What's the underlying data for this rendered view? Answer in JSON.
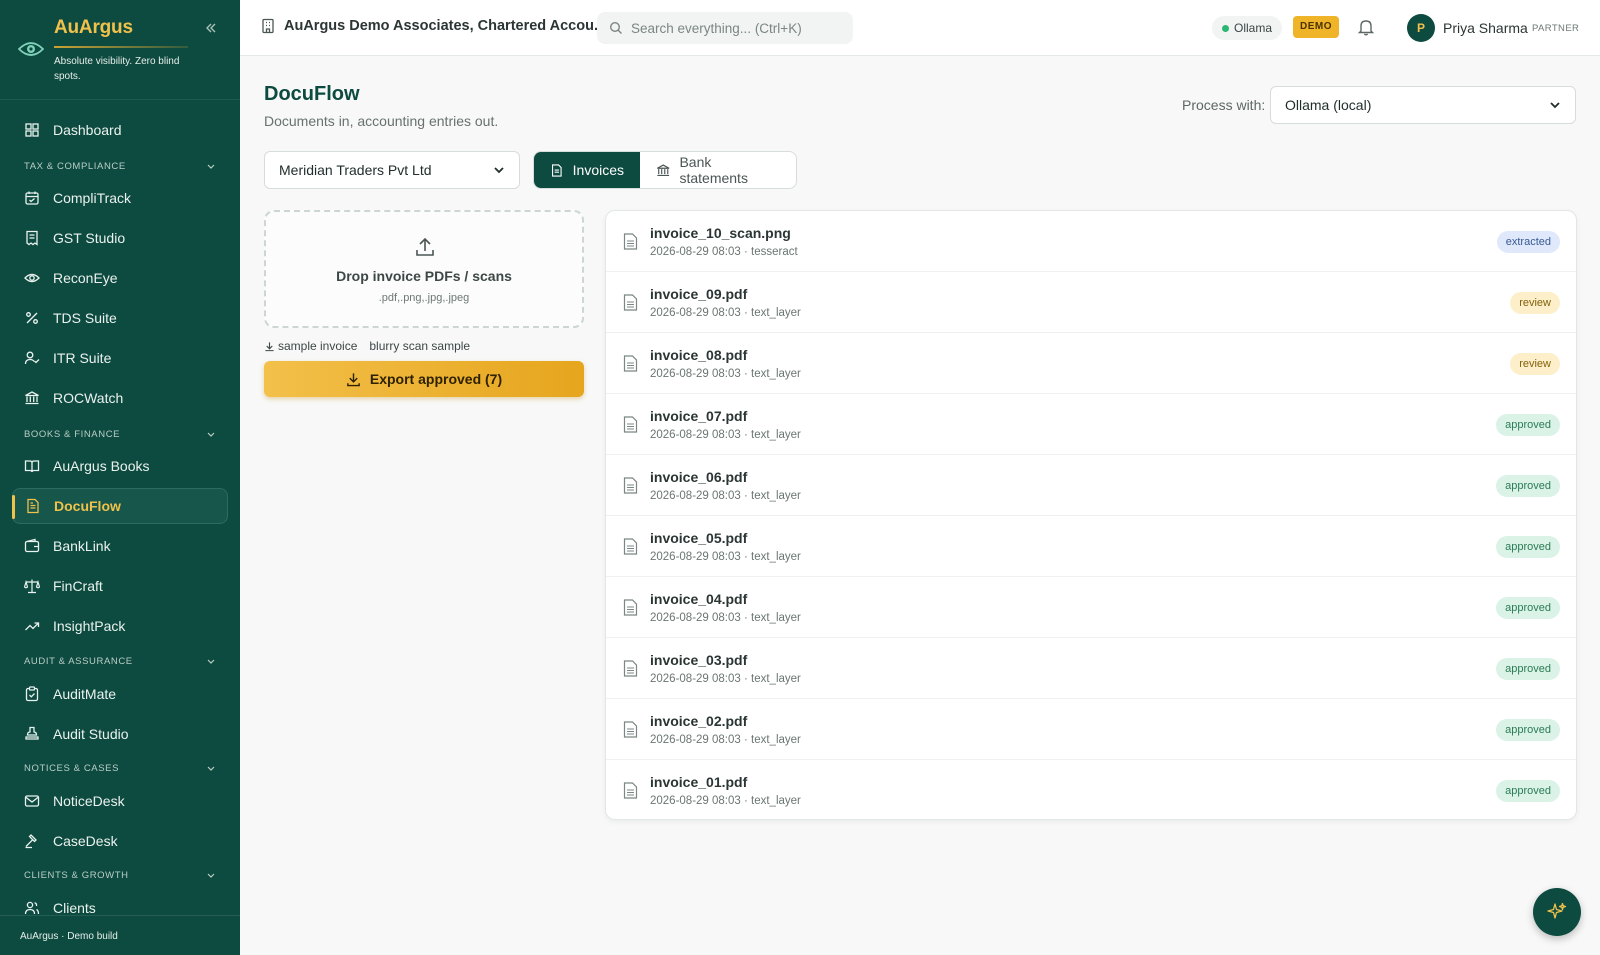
{
  "brand": {
    "name": "AuArgus",
    "tagline": "Absolute visibility. Zero blind spots."
  },
  "nav": {
    "dashboard": "Dashboard",
    "groups": {
      "tax": "TAX & COMPLIANCE",
      "books": "BOOKS & FINANCE",
      "audit": "AUDIT & ASSURANCE",
      "notices": "NOTICES & CASES",
      "clients": "CLIENTS & GROWTH"
    },
    "items": {
      "complitrack": "CompliTrack",
      "gst": "GST Studio",
      "reconeye": "ReconEye",
      "tds": "TDS Suite",
      "itr": "ITR Suite",
      "rocwatch": "ROCWatch",
      "books": "AuArgus Books",
      "docuflow": "DocuFlow",
      "banklink": "BankLink",
      "fincraft": "FinCraft",
      "insightpack": "InsightPack",
      "auditmate": "AuditMate",
      "auditstudio": "Audit Studio",
      "noticedesk": "NoticeDesk",
      "casedesk": "CaseDesk",
      "clients": "Clients"
    },
    "footer": "AuArgus · Demo build"
  },
  "topbar": {
    "org": "AuArgus Demo Associates, Chartered Accou...",
    "search_placeholder": "Search everything... (Ctrl+K)",
    "engine_status": "Ollama",
    "demo_badge": "DEMO",
    "user_initial": "P",
    "user_name": "Priya Sharma",
    "user_role": "PARTNER"
  },
  "page": {
    "title": "DocuFlow",
    "subtitle": "Documents in, accounting entries out.",
    "process_label": "Process with:",
    "process_value": "Ollama (local)",
    "client_value": "Meridian Traders Pvt Ltd",
    "tabs": {
      "invoices": "Invoices",
      "bank": "Bank statements"
    },
    "dropzone": {
      "title": "Drop invoice PDFs / scans",
      "types": ".pdf,.png,.jpg,.jpeg"
    },
    "samples": {
      "sample_invoice": "sample invoice",
      "blurry_sample": "blurry scan sample"
    },
    "export_label": "Export approved (7)"
  },
  "documents": [
    {
      "name": "invoice_10_scan.png",
      "meta": "2026-08-29 08:03 · tesseract",
      "status": "extracted"
    },
    {
      "name": "invoice_09.pdf",
      "meta": "2026-08-29 08:03 · text_layer",
      "status": "review"
    },
    {
      "name": "invoice_08.pdf",
      "meta": "2026-08-29 08:03 · text_layer",
      "status": "review"
    },
    {
      "name": "invoice_07.pdf",
      "meta": "2026-08-29 08:03 · text_layer",
      "status": "approved"
    },
    {
      "name": "invoice_06.pdf",
      "meta": "2026-08-29 08:03 · text_layer",
      "status": "approved"
    },
    {
      "name": "invoice_05.pdf",
      "meta": "2026-08-29 08:03 · text_layer",
      "status": "approved"
    },
    {
      "name": "invoice_04.pdf",
      "meta": "2026-08-29 08:03 · text_layer",
      "status": "approved"
    },
    {
      "name": "invoice_03.pdf",
      "meta": "2026-08-29 08:03 · text_layer",
      "status": "approved"
    },
    {
      "name": "invoice_02.pdf",
      "meta": "2026-08-29 08:03 · text_layer",
      "status": "approved"
    },
    {
      "name": "invoice_01.pdf",
      "meta": "2026-08-29 08:03 · text_layer",
      "status": "approved"
    }
  ],
  "colors": {
    "sidebar": "#0d4a40",
    "accent": "#f1c24b",
    "approved": "#2a7c55",
    "review": "#84610a",
    "extracted": "#3a5a93"
  }
}
